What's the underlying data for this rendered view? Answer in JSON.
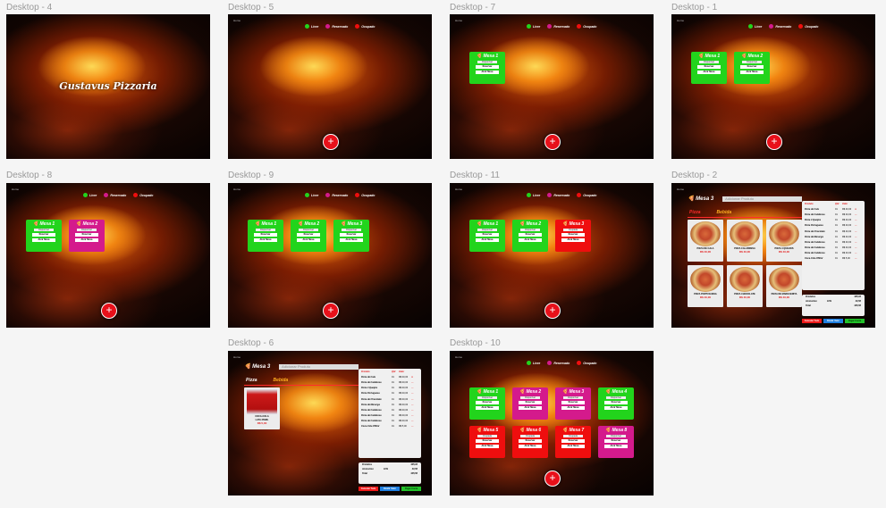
{
  "frames": {
    "d4": {
      "label": "Desktop - 4",
      "brand": "Gustavus Pizzaria"
    },
    "d5": {
      "label": "Desktop - 5"
    },
    "d7": {
      "label": "Desktop - 7"
    },
    "d1": {
      "label": "Desktop - 1"
    },
    "d8": {
      "label": "Desktop - 8"
    },
    "d9": {
      "label": "Desktop - 9"
    },
    "d11": {
      "label": "Desktop - 11"
    },
    "d2": {
      "label": "Desktop - 2"
    },
    "d6": {
      "label": "Desktop - 6"
    },
    "d10": {
      "label": "Desktop - 10"
    }
  },
  "small_label": "Home",
  "legend": {
    "livre": "Livre",
    "reservado": "Reservado",
    "ocupado": "Ocupado"
  },
  "colors": {
    "livre": "#22d41c",
    "reservado": "#d41a8c",
    "ocupado": "#ef0e0e"
  },
  "add_button": "+",
  "mesa": {
    "m1": "Mesa 1",
    "m2": "Mesa 2",
    "m3": "Mesa 3",
    "m4": "Mesa 4",
    "m5": "Mesa 5",
    "m6": "Mesa 6",
    "m7": "Mesa 7",
    "m8": "Mesa 8",
    "status_livre": "Disponível",
    "status_ocupada": "Ocupada",
    "btn_reservar": "Reservar",
    "btn_abrir": "Abrir Mesa"
  },
  "order": {
    "title": "Mesa 3",
    "add_placeholder": "Adicionar Produto",
    "tab_pizza": "Pizza",
    "tab_bebida": "Bebida",
    "pizzas": [
      {
        "name": "PIZZA DE CALA",
        "price": "R$ 40,00"
      },
      {
        "name": "PIZZA CALABRESA",
        "price": "R$ 40,00"
      },
      {
        "name": "PIZZA 4 QUEIJOS",
        "price": "R$ 40,00"
      },
      {
        "name": "PIZZA PORTUGUESA",
        "price": "R$ 40,00"
      },
      {
        "name": "PIZZA CHOCOLATE",
        "price": "R$ 40,00"
      },
      {
        "name": "PIZZA DE MARGUERITA",
        "price": "R$ 40,00"
      }
    ],
    "drink": {
      "name": "COCA-COLA",
      "sub": "LATA 350ML",
      "price": "R$ 5,00"
    },
    "table_head": {
      "prod": "Produto",
      "qtd": "Qtd",
      "val": "Valor"
    },
    "items": [
      {
        "name": "Pizza de Cala",
        "qtd": "01",
        "val": "R$ 40,00"
      },
      {
        "name": "Pizza de Calabresa",
        "qtd": "01",
        "val": "R$ 40,00"
      },
      {
        "name": "Pizza 4 Queijos",
        "qtd": "01",
        "val": "R$ 40,00"
      },
      {
        "name": "Pizza Portuguesa",
        "qtd": "01",
        "val": "R$ 40,00"
      },
      {
        "name": "Pizza de Chocolate",
        "qtd": "01",
        "val": "R$ 40,00"
      },
      {
        "name": "Pizza de Marucga",
        "qtd": "01",
        "val": "R$ 40,00"
      },
      {
        "name": "Pizza de Calabresa",
        "qtd": "01",
        "val": "R$ 40,00"
      },
      {
        "name": "Pizza de Calabresa",
        "qtd": "01",
        "val": "R$ 40,00"
      },
      {
        "name": "Pizza de Calabresa",
        "qtd": "01",
        "val": "R$ 40,00"
      },
      {
        "name": "Coca-Cola 350ml",
        "qtd": "01",
        "val": "R$ 5,00"
      }
    ],
    "totals": {
      "produto_label": "Produtos",
      "produto_val": "405,00",
      "servico_label": "Acréscimo",
      "servico_pct": "10%",
      "servico_val": "40,50",
      "total_label": "Total",
      "total_val": "445,50"
    },
    "actions": {
      "cancel": "Cancelar Todo",
      "split": "Dividir Valor",
      "pay": "Pagar Conta"
    }
  }
}
